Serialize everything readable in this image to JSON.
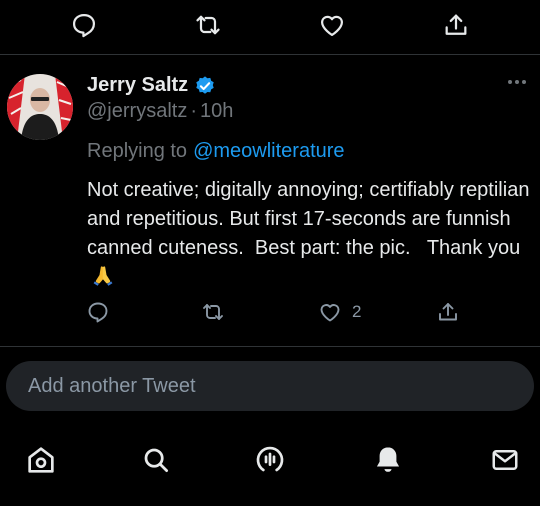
{
  "top_actions": [
    "reply-icon",
    "retweet-icon",
    "like-icon",
    "share-icon"
  ],
  "reply": {
    "author": {
      "display_name": "Jerry Saltz",
      "handle": "@jerrysaltz",
      "separator": "·",
      "time": "10h",
      "verified": true
    },
    "replying_to_label": "Replying to",
    "replying_to_handle": "@meowliterature",
    "text": "Not creative; digitally annoying; certifiably reptilian and repetitious. But first 17-seconds are funnish  canned cuteness.  Best part: the pic.   Thank you",
    "emoji": "folded-hands",
    "actions": {
      "like_count": "2"
    }
  },
  "compose": {
    "placeholder": "Add another Tweet"
  },
  "bottom_nav": [
    "home-icon",
    "search-icon",
    "spaces-icon",
    "notifications-icon",
    "messages-icon"
  ],
  "colors": {
    "background": "#000000",
    "text": "#e7e9ea",
    "muted": "#71767b",
    "accent": "#1d9bf0",
    "compose_bg": "#202327"
  }
}
